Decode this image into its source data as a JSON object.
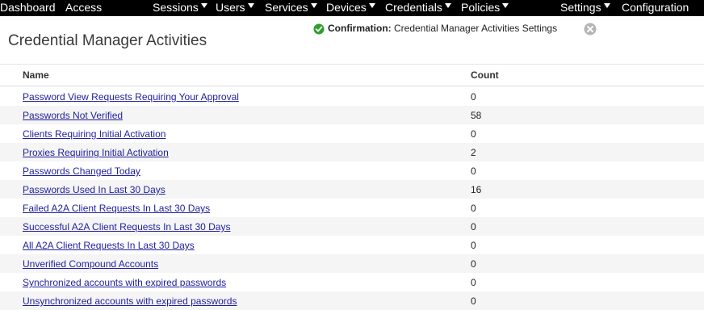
{
  "nav": {
    "dashboard": "Dashboard",
    "access": "Access",
    "sessions": "Sessions",
    "users": "Users",
    "services": "Services",
    "devices": "Devices",
    "credentials": "Credentials",
    "policies": "Policies",
    "settings": "Settings",
    "configuration": "Configuration"
  },
  "page": {
    "title": "Credential Manager Activities"
  },
  "confirmation": {
    "label": "Confirmation:",
    "message": "Credential Manager Activities Settings",
    "icon": "check-circle-icon",
    "close_icon": "close-circle-icon"
  },
  "table": {
    "headers": {
      "name": "Name",
      "count": "Count"
    },
    "rows": [
      {
        "name": "Password View Requests Requiring Your Approval",
        "count": "0"
      },
      {
        "name": "Passwords Not Verified",
        "count": "58"
      },
      {
        "name": "Clients Requiring Initial Activation",
        "count": "0"
      },
      {
        "name": "Proxies Requiring Initial Activation",
        "count": "2"
      },
      {
        "name": "Passwords Changed Today",
        "count": "0"
      },
      {
        "name": "Passwords Used In Last 30 Days",
        "count": "16"
      },
      {
        "name": "Failed A2A Client Requests In Last 30 Days",
        "count": "0"
      },
      {
        "name": "Successful A2A Client Requests In Last 30 Days",
        "count": "0"
      },
      {
        "name": "All A2A Client Requests In Last 30 Days",
        "count": "0"
      },
      {
        "name": "Unverified Compound Accounts",
        "count": "0"
      },
      {
        "name": "Synchronized accounts with expired passwords",
        "count": "0"
      },
      {
        "name": "Unsynchronized accounts with expired passwords",
        "count": "0"
      }
    ]
  },
  "colors": {
    "navbar_bg": "#000000",
    "link": "#1f1f9e",
    "row_alt": "#f5f5f5",
    "confirm_green": "#2e9e2e"
  }
}
